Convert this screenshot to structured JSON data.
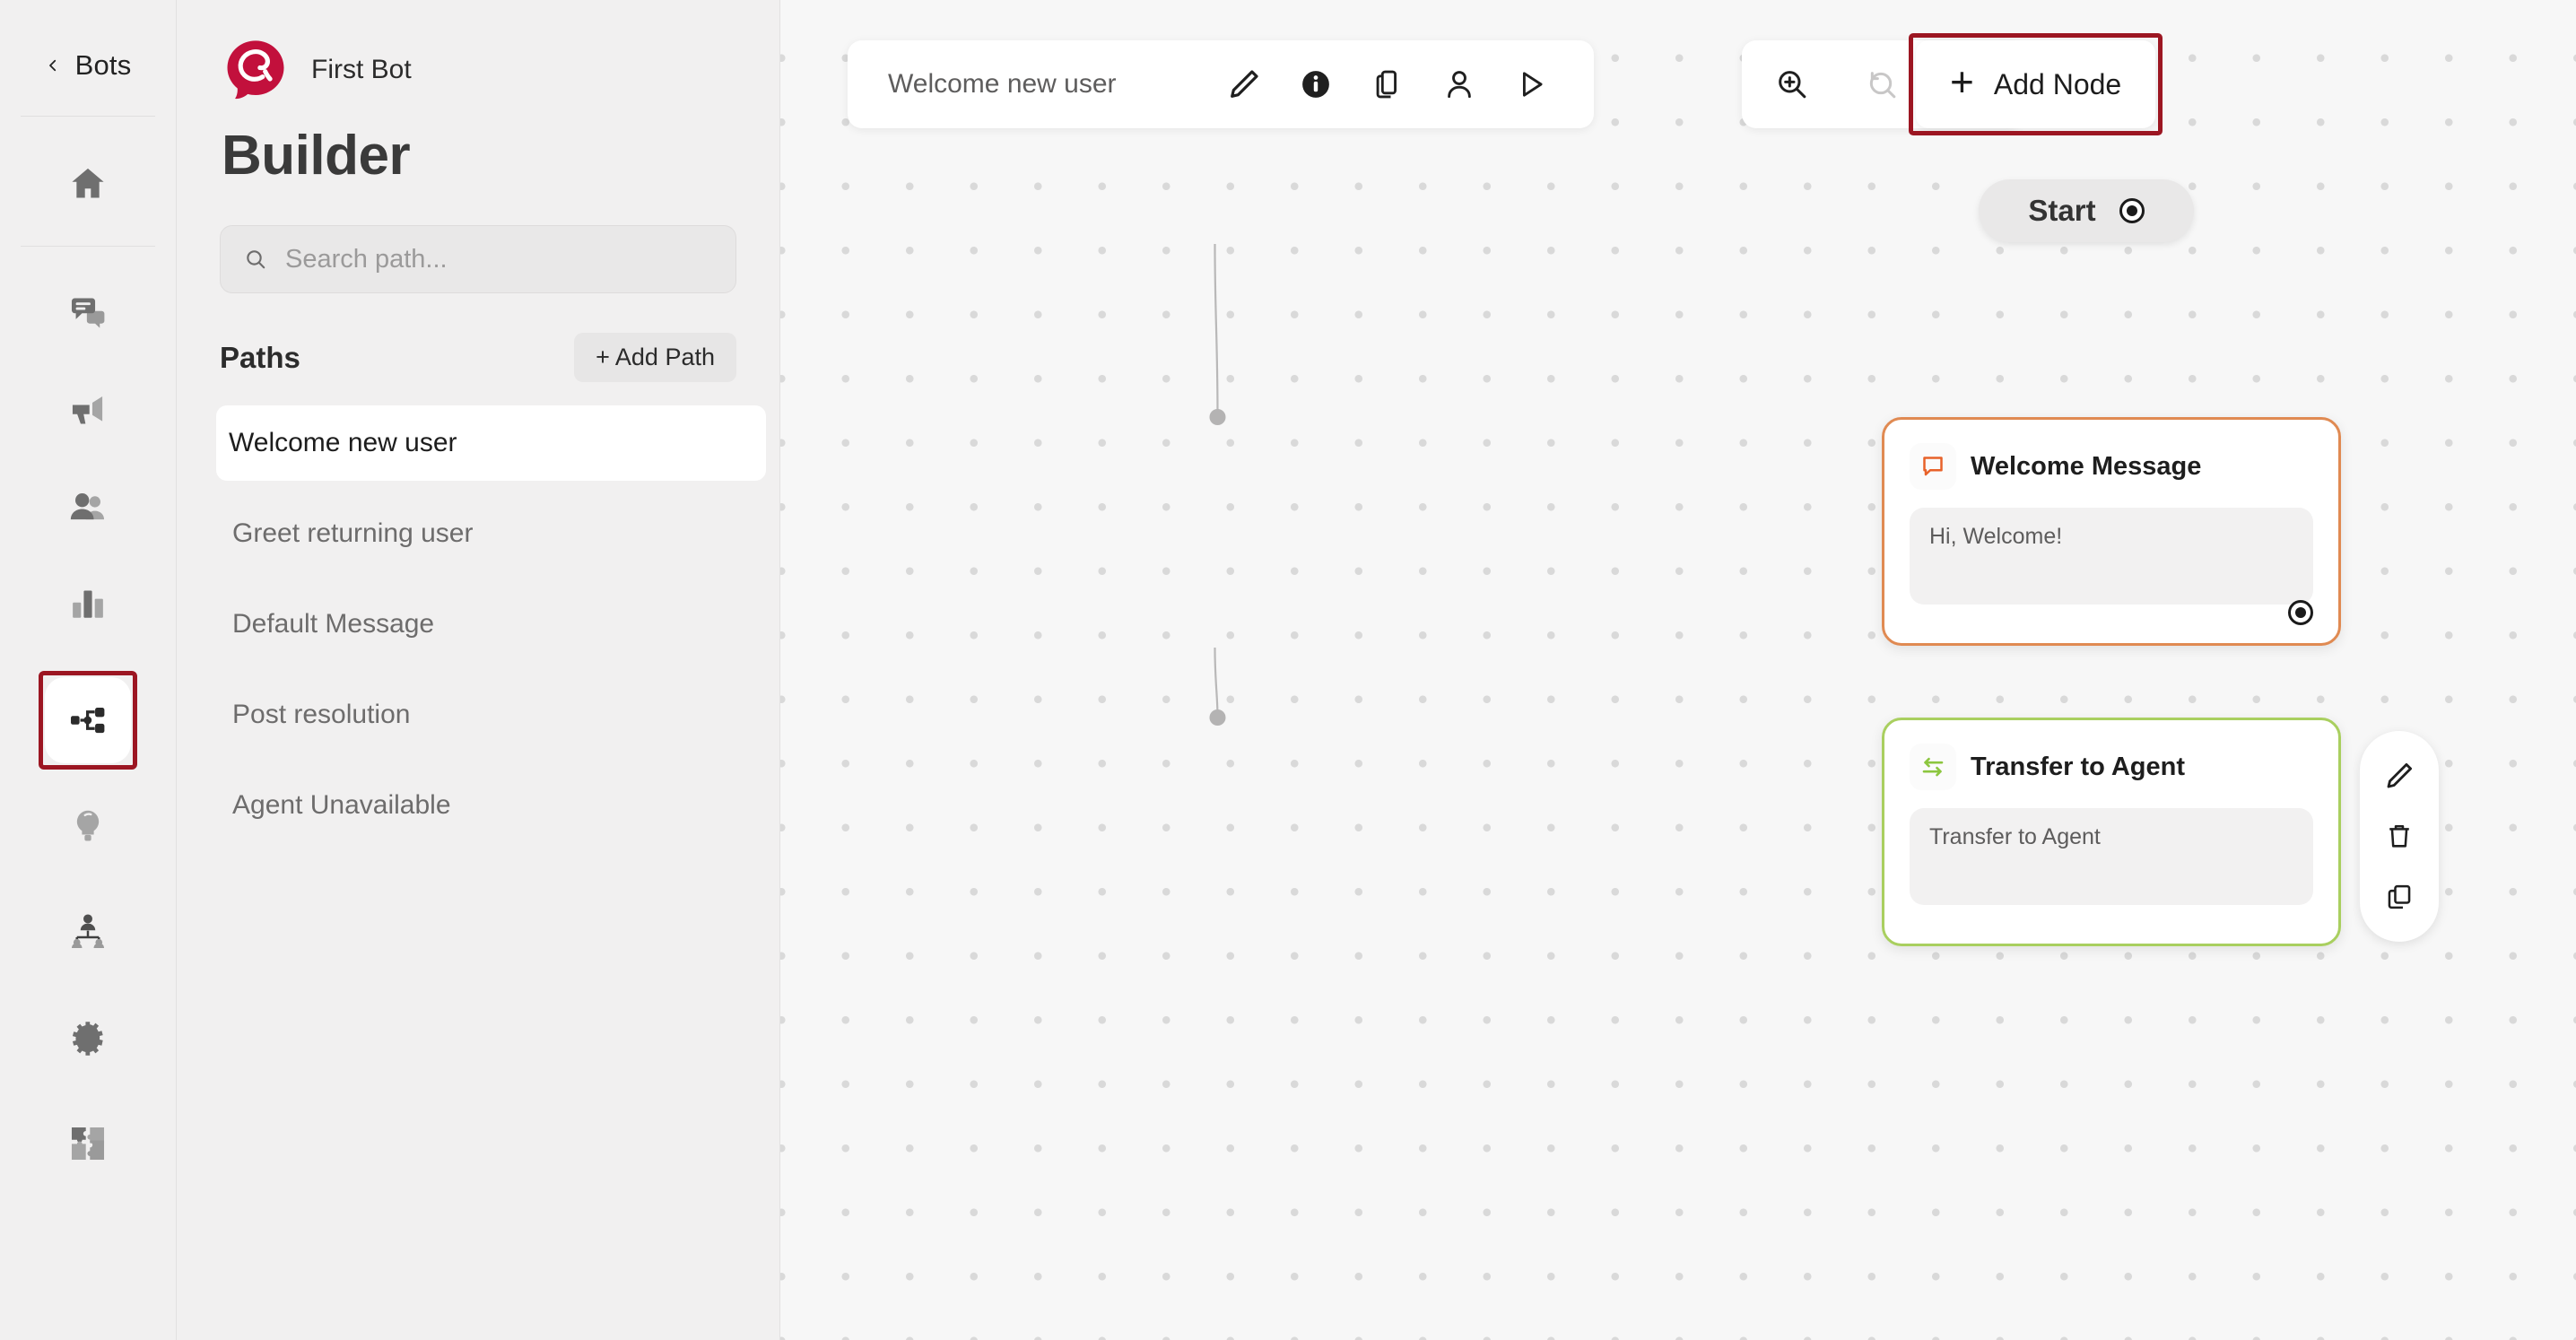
{
  "rail": {
    "back": {
      "label": "Bots",
      "icon": "chevron-left-icon"
    },
    "items": [
      {
        "id": "home",
        "icon": "home-icon",
        "active": false
      },
      {
        "id": "conversations",
        "icon": "chat-bubbles-icon",
        "active": false
      },
      {
        "id": "campaigns",
        "icon": "megaphone-icon",
        "active": false
      },
      {
        "id": "contacts",
        "icon": "people-icon",
        "active": false
      },
      {
        "id": "analytics",
        "icon": "bar-chart-icon",
        "active": false
      },
      {
        "id": "bot-builder",
        "icon": "flow-nodes-icon",
        "active": true
      },
      {
        "id": "insights",
        "icon": "lightbulb-icon",
        "active": false
      },
      {
        "id": "teams",
        "icon": "org-chart-icon",
        "active": false
      },
      {
        "id": "settings",
        "icon": "gear-icon",
        "active": false
      },
      {
        "id": "integrations",
        "icon": "puzzle-piece-icon",
        "active": false
      }
    ]
  },
  "panel": {
    "bot_name": "First Bot",
    "page_title": "Builder",
    "logo_icon": "brand-speech-bubble-logo",
    "search": {
      "placeholder": "Search path...",
      "value": "",
      "icon": "search-icon"
    },
    "paths_heading": "Paths",
    "add_path_label": "+ Add Path",
    "paths": [
      {
        "label": "Welcome new user",
        "active": true
      },
      {
        "label": "Greet returning user",
        "active": false
      },
      {
        "label": "Default Message",
        "active": false
      },
      {
        "label": "Post resolution",
        "active": false
      },
      {
        "label": "Agent Unavailable",
        "active": false
      }
    ]
  },
  "canvas": {
    "toolbar": {
      "path_title": "Welcome new user",
      "buttons": [
        {
          "id": "edit",
          "icon": "pencil-icon"
        },
        {
          "id": "info",
          "icon": "info-circle-icon"
        },
        {
          "id": "duplicate",
          "icon": "copy-icon"
        },
        {
          "id": "assign",
          "icon": "user-icon"
        },
        {
          "id": "run",
          "icon": "play-icon"
        }
      ]
    },
    "zoom_controls": [
      {
        "id": "zoom-in",
        "icon": "zoom-in-icon",
        "disabled": false
      },
      {
        "id": "reset",
        "icon": "reset-icon",
        "disabled": true
      },
      {
        "id": "zoom-out",
        "icon": "zoom-out-icon",
        "disabled": false
      }
    ],
    "add_node": {
      "plus": "+",
      "label": "Add Node"
    },
    "start_node": {
      "label": "Start",
      "handle_icon": "output-handle-icon"
    },
    "nodes": [
      {
        "id": "welcome-message",
        "title": "Welcome Message",
        "body": "Hi, Welcome!",
        "icon": "message-bubble-icon",
        "border_color": "#e08a52",
        "icon_color": "#e8622a"
      },
      {
        "id": "transfer-to-agent",
        "title": "Transfer to Agent",
        "body": "Transfer to Agent",
        "icon": "transfer-arrows-icon",
        "border_color": "#a9cf5f",
        "icon_color": "#8cc63f"
      }
    ],
    "node_actions": [
      {
        "id": "edit-node",
        "icon": "pencil-icon"
      },
      {
        "id": "delete-node",
        "icon": "trash-icon"
      },
      {
        "id": "duplicate-node",
        "icon": "copy-icon"
      }
    ]
  },
  "colors": {
    "brand": "#c2103c",
    "highlight_box": "#9c1622",
    "canvas_bg": "#f7f7f7",
    "panel_bg": "#f1f0f0",
    "node_orange": "#e08a52",
    "node_green": "#a9cf5f"
  }
}
